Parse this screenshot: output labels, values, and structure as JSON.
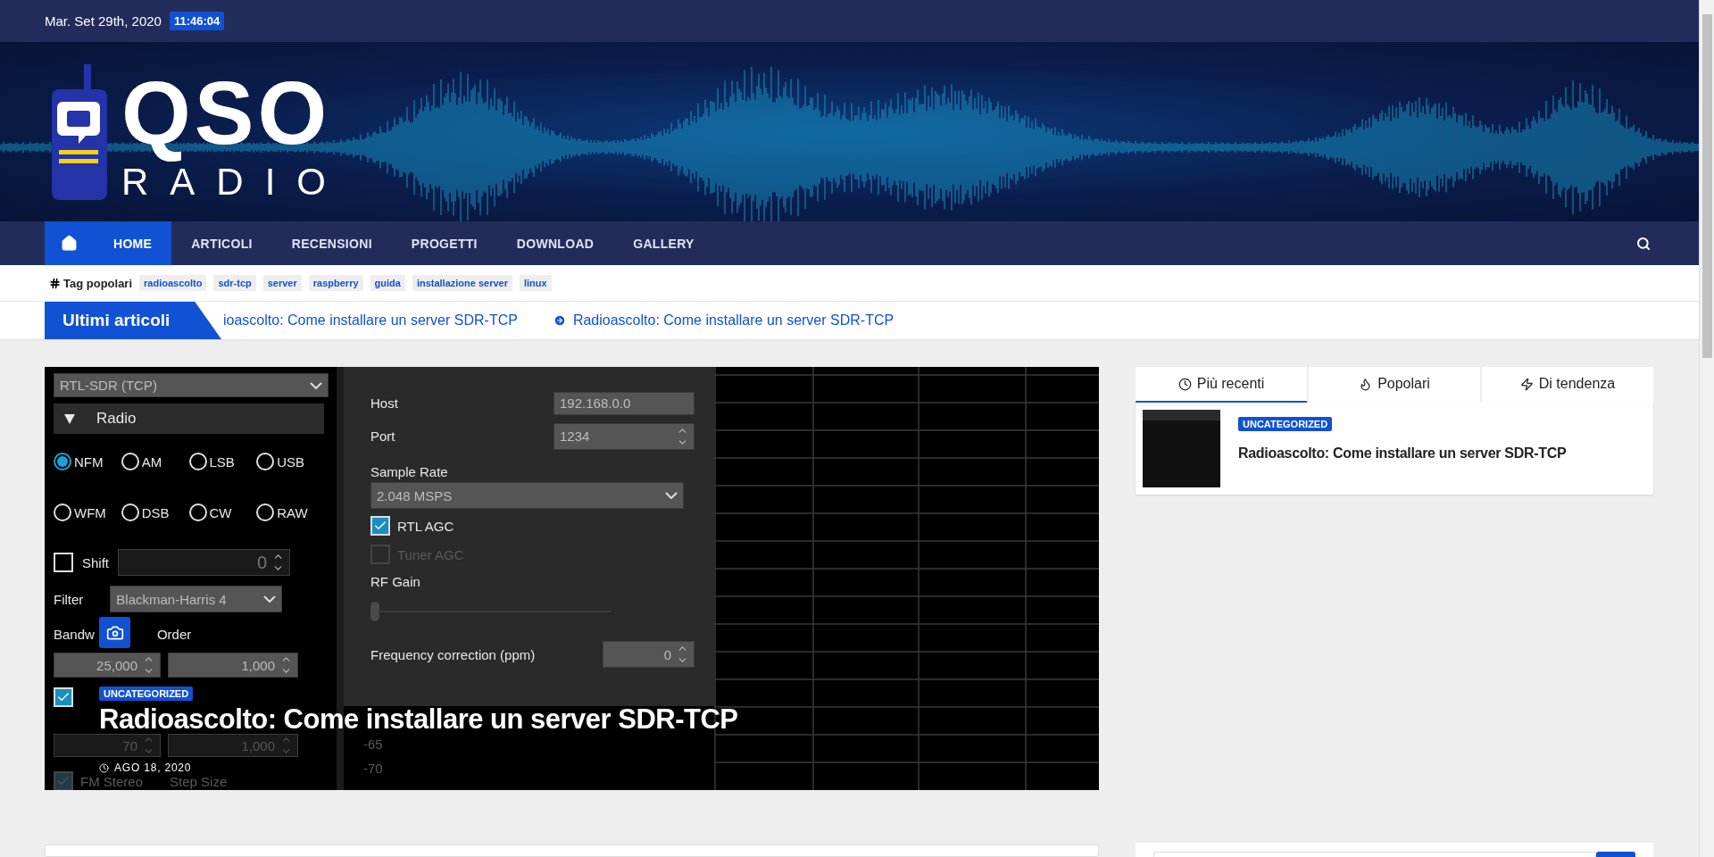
{
  "topbar": {
    "date": "Mar. Set 29th, 2020",
    "time": "11:46:04"
  },
  "logo": {
    "line1": "QSO",
    "line2": "RADIO"
  },
  "nav": {
    "items": [
      {
        "label": "HOME",
        "selected": true
      },
      {
        "label": "ARTICOLI",
        "selected": false
      },
      {
        "label": "RECENSIONI",
        "selected": false
      },
      {
        "label": "PROGETTI",
        "selected": false
      },
      {
        "label": "DOWNLOAD",
        "selected": false
      },
      {
        "label": "GALLERY",
        "selected": false
      }
    ]
  },
  "tags": {
    "heading": "Tag popolari",
    "items": [
      "radioascolto",
      "sdr-tcp",
      "server",
      "raspberry",
      "guida",
      "installazione server",
      "linux"
    ]
  },
  "ticker": {
    "label": "Ultimi articoli",
    "items": [
      "ioascolto: Come installare un server SDR-TCP",
      "Radioascolto: Come installare un server SDR-TCP"
    ]
  },
  "featured": {
    "category": "UNCATEGORIZED",
    "title": "Radioascolto: Come installare un server SDR-TCP",
    "date": "AGO 18, 2020",
    "screenshot": {
      "device": "RTL-SDR (TCP)",
      "section": "Radio",
      "modes": [
        {
          "label": "NFM",
          "selected": true
        },
        {
          "label": "AM",
          "selected": false
        },
        {
          "label": "LSB",
          "selected": false
        },
        {
          "label": "USB",
          "selected": false
        },
        {
          "label": "WFM",
          "selected": false
        },
        {
          "label": "DSB",
          "selected": false
        },
        {
          "label": "CW",
          "selected": false
        },
        {
          "label": "RAW",
          "selected": false
        }
      ],
      "shift": {
        "label": "Shift",
        "checked": false,
        "value": "0"
      },
      "filter": {
        "label": "Filter",
        "value": "Blackman-Harris 4"
      },
      "bandwidth_label": "Bandw",
      "order_label": "Order",
      "bandwidth": {
        "value": "25,000",
        "disabled": false
      },
      "order": {
        "value": "1,000",
        "disabled": false
      },
      "squelch": {
        "checked": true
      },
      "squelch_level": {
        "value": "70",
        "disabled": true
      },
      "cw_shift": {
        "value": "1,000",
        "disabled": true
      },
      "fm_stereo": {
        "label": "FM Stereo",
        "checked": true,
        "disabled": true
      },
      "step_size_label": "Step Size",
      "host": {
        "label": "Host",
        "value": "192.168.0.0"
      },
      "port": {
        "label": "Port",
        "value": "1234"
      },
      "sample_rate": {
        "label": "Sample Rate",
        "value": "2.048 MSPS"
      },
      "agc": [
        {
          "label": "RTL AGC",
          "checked": true,
          "disabled": false
        },
        {
          "label": "Tuner AGC",
          "checked": false,
          "disabled": true
        }
      ],
      "rf_gain": {
        "label": "RF Gain",
        "level": 0
      },
      "freq_correction": {
        "label": "Frequency correction (ppm)",
        "value": "0"
      },
      "scale_labels": [
        "-65",
        "-70"
      ]
    }
  },
  "sidebar": {
    "tabs": [
      {
        "label": "Più recenti",
        "selected": true
      },
      {
        "label": "Popolari",
        "selected": false
      },
      {
        "label": "Di tendenza",
        "selected": false
      }
    ],
    "posts": [
      {
        "category": "UNCATEGORIZED",
        "title": "Radioascolto: Come installare un server SDR-TCP"
      }
    ]
  }
}
